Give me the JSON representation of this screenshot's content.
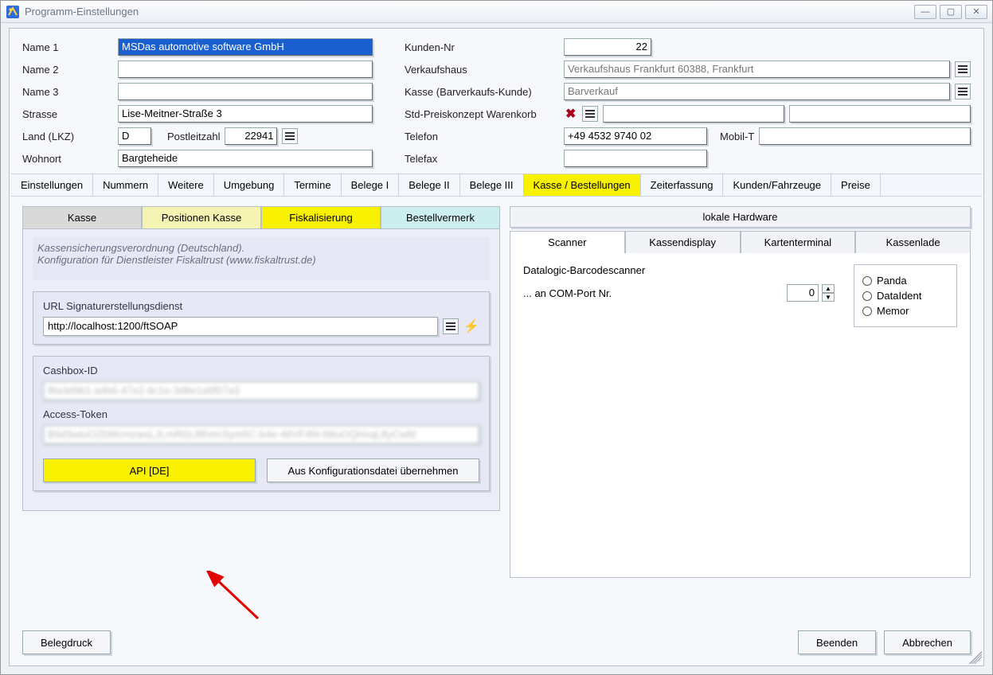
{
  "window": {
    "title": "Programm-Einstellungen"
  },
  "top": {
    "labels": {
      "name1": "Name 1",
      "name2": "Name 2",
      "name3": "Name 3",
      "strasse": "Strasse",
      "land": "Land (LKZ)",
      "plz_label": "Postleitzahl",
      "wohnort": "Wohnort",
      "kundennr": "Kunden-Nr",
      "verkaufshaus": "Verkaufshaus",
      "kasse": "Kasse (Barverkaufs-Kunde)",
      "std_preis": "Std-Preiskonzept Warenkorb",
      "telefon": "Telefon",
      "mobil": "Mobil-T",
      "telefax": "Telefax"
    },
    "values": {
      "name1": "MSDas automotive software GmbH",
      "name2": "",
      "name3": "",
      "strasse": "Lise-Meitner-Straße 3",
      "land": "D",
      "plz": "22941",
      "wohnort": "Bargteheide",
      "kundennr": "22",
      "verkaufshaus": "Verkaufshaus Frankfurt 60388, Frankfurt",
      "kasse": "Barverkauf",
      "std_preis_a": "",
      "std_preis_b": "",
      "telefon": "+49 4532 9740 02",
      "mobil": "",
      "telefax": ""
    }
  },
  "maintabs": [
    "Einstellungen",
    "Nummern",
    "Weitere",
    "Umgebung",
    "Termine",
    "Belege I",
    "Belege II",
    "Belege III",
    "Kasse / Bestellungen",
    "Zeiterfassung",
    "Kunden/Fahrzeuge",
    "Preise"
  ],
  "maintab_active_index": 8,
  "left": {
    "subtabs": [
      "Kasse",
      "Positionen Kasse",
      "Fiskalisierung",
      "Bestellvermerk"
    ],
    "subtab_active_index": 2,
    "desc1": "Kassensicherungsverordnung (Deutschland).",
    "desc2": "Konfiguration für Dienstleister Fiskaltrust (www.fiskaltrust.de)",
    "url_label": "URL Signaturerstellungsdienst",
    "url_value": "http://localhost:1200/ftSOAP",
    "cashbox_label": "Cashbox-ID",
    "cashbox_value": "f8a3d9b1-a4b6-47e2-9c1e-3d8e1a6f07a3",
    "token_label": "Access-Token",
    "token_value": "B9d3wtuO25WcmzwxLJLmR0zJ8hmc5ym5C-b4e-48VF4f4-tWuOQHxqL8yCwfd",
    "btn_api": "API [DE]",
    "btn_konfig": "Aus Konfigurationsdatei übernehmen"
  },
  "right": {
    "header": "lokale Hardware",
    "subtabs": [
      "Scanner",
      "Kassendisplay",
      "Kartenterminal",
      "Kassenlade"
    ],
    "subtab_active_index": 0,
    "scanner_label": "Datalogic-Barcodescanner",
    "com_label": "... an COM-Port Nr.",
    "com_value": "0",
    "radios": [
      "Panda",
      "DataIdent",
      "Memor"
    ]
  },
  "bottom": {
    "belegdruck": "Belegdruck",
    "beenden": "Beenden",
    "abbrechen": "Abbrechen"
  }
}
